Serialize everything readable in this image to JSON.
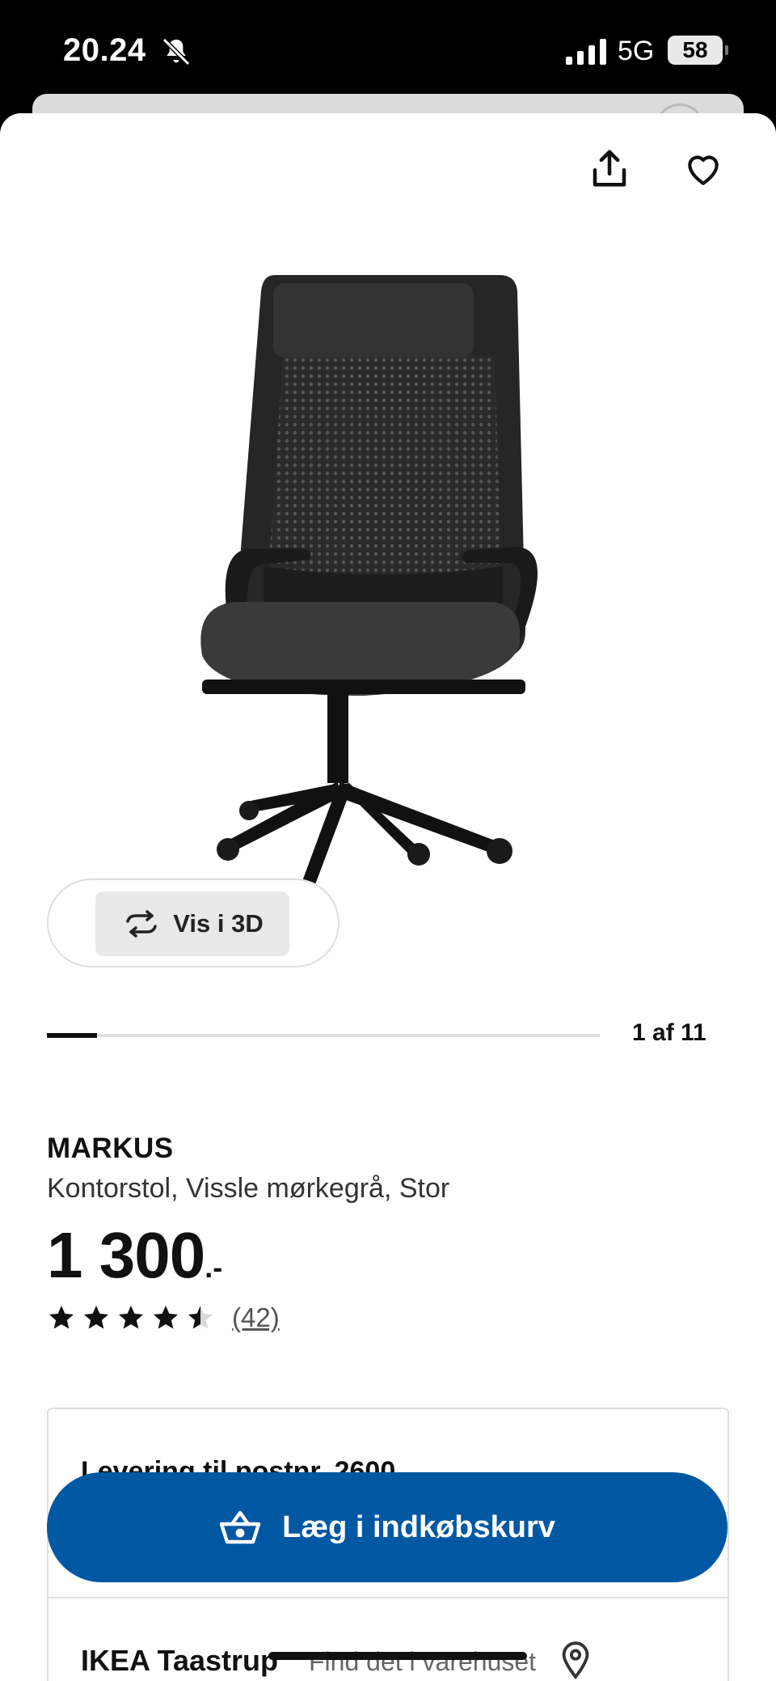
{
  "status_bar": {
    "time": "20.24",
    "network": "5G",
    "battery": "58"
  },
  "header": {
    "share_icon": "share-icon",
    "favorite_icon": "heart-icon"
  },
  "gallery": {
    "view_3d_label": "Vis i 3D",
    "view_3d_icon": "rotate-icon",
    "indicator": "1 af 11",
    "current_index": 1,
    "total": 11
  },
  "product": {
    "name": "MARKUS",
    "description": "Kontorstol, Vissle mørkegrå, Stor",
    "price_integer": "1 300",
    "price_decimal": ".-",
    "rating_value": 4.5,
    "rating_max": 5,
    "review_count": "(42)"
  },
  "availability": {
    "delivery_title": "Levering til postnr. 2600",
    "store_name": "IKEA Taastrup",
    "store_find_text": "Find det i varehuset",
    "store_icon": "location-pin-icon"
  },
  "actions": {
    "add_to_cart_label": "Læg i indkøbskurv",
    "add_to_cart_icon": "basket-icon",
    "button_color": "#0058a3"
  }
}
